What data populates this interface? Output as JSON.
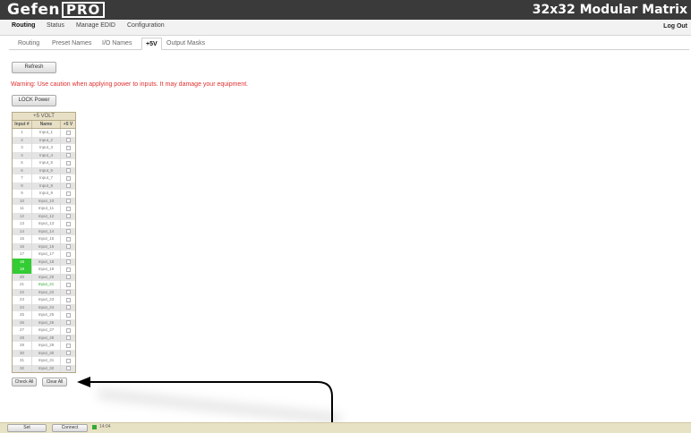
{
  "header": {
    "brand": "Gefen",
    "brand_boxed": "PRO",
    "product": "32x32 Modular Matrix"
  },
  "tabs": [
    {
      "label": "Routing",
      "active": true
    },
    {
      "label": "Status",
      "active": false
    },
    {
      "label": "Manage EDID",
      "active": false
    },
    {
      "label": "Configuration",
      "active": false
    }
  ],
  "logout_label": "Log Out",
  "subtabs": [
    {
      "label": "Routing",
      "active": false
    },
    {
      "label": "Preset Names",
      "active": false
    },
    {
      "label": "I/O Names",
      "active": false
    },
    {
      "label": "+5V",
      "active": true
    },
    {
      "label": "Output Masks",
      "active": false
    }
  ],
  "refresh_label": "Refresh",
  "warning": "Warning: Use caution when applying power to inputs. It may damage your equipment.",
  "lock_label": "LOCK Power",
  "table": {
    "title": "+5 VOLT",
    "headers": [
      "Input #",
      "Name",
      "+5 V"
    ],
    "rows": [
      {
        "num": "1",
        "name": "Input_1"
      },
      {
        "num": "2",
        "name": "Input_2"
      },
      {
        "num": "3",
        "name": "Input_3"
      },
      {
        "num": "4",
        "name": "Input_4"
      },
      {
        "num": "5",
        "name": "Input_5"
      },
      {
        "num": "6",
        "name": "Input_6"
      },
      {
        "num": "7",
        "name": "Input_7"
      },
      {
        "num": "8",
        "name": "Input_8"
      },
      {
        "num": "9",
        "name": "Input_9"
      },
      {
        "num": "10",
        "name": "Input_10"
      },
      {
        "num": "11",
        "name": "Input_11"
      },
      {
        "num": "12",
        "name": "Input_12"
      },
      {
        "num": "13",
        "name": "Input_13"
      },
      {
        "num": "14",
        "name": "Input_14"
      },
      {
        "num": "15",
        "name": "Input_15"
      },
      {
        "num": "16",
        "name": "Input_16"
      },
      {
        "num": "17",
        "name": "Input_17"
      },
      {
        "num": "18",
        "name": "Input_18",
        "highlight": true
      },
      {
        "num": "19",
        "name": "Input_19",
        "highlight": true
      },
      {
        "num": "20",
        "name": "Input_20"
      },
      {
        "num": "21",
        "name": "Input_21",
        "green": true
      },
      {
        "num": "22",
        "name": "Input_22"
      },
      {
        "num": "23",
        "name": "Input_23"
      },
      {
        "num": "24",
        "name": "Input_24"
      },
      {
        "num": "25",
        "name": "Input_25"
      },
      {
        "num": "26",
        "name": "Input_26"
      },
      {
        "num": "27",
        "name": "Input_27"
      },
      {
        "num": "28",
        "name": "Input_28"
      },
      {
        "num": "29",
        "name": "Input_29"
      },
      {
        "num": "30",
        "name": "Input_30"
      },
      {
        "num": "31",
        "name": "Input_31"
      },
      {
        "num": "32",
        "name": "Input_32"
      }
    ]
  },
  "check_all_label": "Check All",
  "clear_all_label": "Clear All",
  "footer": {
    "set_label": "Set",
    "connect_label": "Connect",
    "status": "14:04"
  },
  "colors": {
    "header_bg": "#3a3a3a",
    "warning": "#e03030",
    "highlight": "#33cc33",
    "footer_bg": "#e8e2c4"
  }
}
